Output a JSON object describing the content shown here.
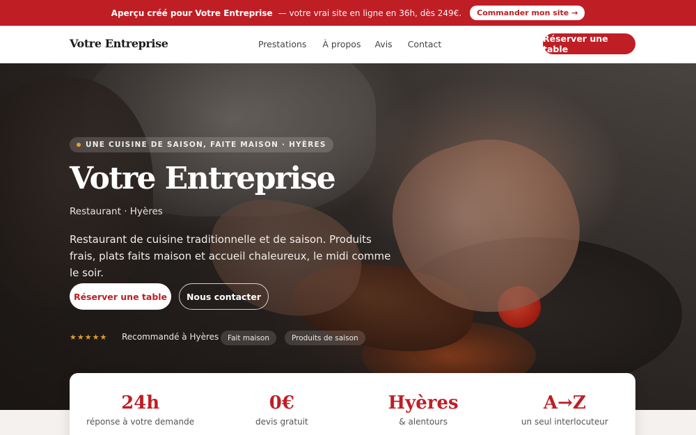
{
  "banner": {
    "lead": "Aperçu créé pour Votre Entreprise",
    "text": "— votre vrai site en ligne en 36h, dès 249€.",
    "cta": "Commander mon site →"
  },
  "nav": {
    "brand": "Votre Entreprise",
    "links": [
      "Prestations",
      "À propos",
      "Avis",
      "Contact"
    ],
    "cta": "Réserver une table"
  },
  "hero": {
    "eyebrow": "UNE CUISINE DE SAISON, FAITE MAISON · HYÈRES",
    "title": "Votre Entreprise",
    "subtitle": "Restaurant · Hyères",
    "description": "Restaurant de cuisine traditionnelle et de saison. Produits frais, plats faits maison et accueil chaleureux, le midi comme le soir.",
    "primary_cta": "Réserver une table",
    "secondary_cta": "Nous contacter",
    "rating_stars": "★★★★★",
    "rating_text": "Recommandé à Hyères",
    "tags": [
      "Fait maison",
      "Produits de saison"
    ]
  },
  "stats": [
    {
      "value": "24h",
      "label": "réponse à votre demande"
    },
    {
      "value": "0€",
      "label": "devis gratuit"
    },
    {
      "value": "Hyères",
      "label": "& alentours"
    },
    {
      "value": "A→Z",
      "label": "un seul interlocuteur"
    }
  ],
  "colors": {
    "accent": "#bf1e25",
    "star": "#e09d2e"
  }
}
